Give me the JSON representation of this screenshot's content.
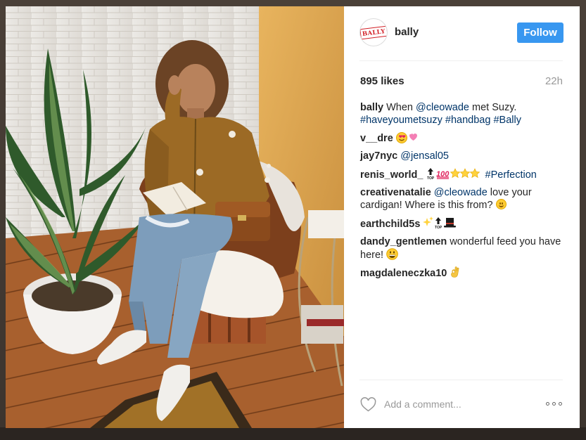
{
  "post": {
    "username": "bally",
    "avatar_logo_text": "BALLY",
    "follow_label": "Follow",
    "likes": "895 likes",
    "time": "22h",
    "comments": [
      {
        "author": "bally",
        "parts": [
          {
            "t": "text",
            "v": "When "
          },
          {
            "t": "mention",
            "v": "@cleowade"
          },
          {
            "t": "text",
            "v": " met Suzy. "
          },
          {
            "t": "tag",
            "v": "#haveyoumetsuzy"
          },
          {
            "t": "text",
            "v": " "
          },
          {
            "t": "tag",
            "v": "#handbag"
          },
          {
            "t": "text",
            "v": " "
          },
          {
            "t": "tag",
            "v": "#Bally"
          }
        ]
      },
      {
        "author": "v__dre",
        "parts": [
          {
            "t": "text",
            "v": ""
          }
        ],
        "emoji": [
          "heart-eyes-emoji",
          "sparkling-heart-emoji"
        ]
      },
      {
        "author": "jay7nyc",
        "parts": [
          {
            "t": "mention",
            "v": "@jensal05"
          }
        ]
      },
      {
        "author": "renis_world_",
        "parts": [
          {
            "t": "tag",
            "v": "#Perfection"
          }
        ],
        "emoji_before": [
          "top-arrow-emoji",
          "hundred-emoji",
          "star-emoji",
          "star-emoji",
          "star-emoji"
        ]
      },
      {
        "author": "creativenatalie",
        "parts": [
          {
            "t": "mention",
            "v": "@cleowade"
          },
          {
            "t": "text",
            "v": " love your cardigan! Where is this from?"
          }
        ],
        "emoji": [
          "smiling-face-emoji"
        ]
      },
      {
        "author": "earthchild5s",
        "parts": [
          {
            "t": "text",
            "v": ""
          }
        ],
        "emoji": [
          "sparkles-emoji",
          "top-arrow-emoji",
          "top-hat-emoji"
        ]
      },
      {
        "author": "dandy_gentlemen",
        "parts": [
          {
            "t": "text",
            "v": "wonderful feed you have here!"
          }
        ],
        "emoji": [
          "grinning-face-emoji"
        ]
      },
      {
        "author": "magdaleneczka10",
        "parts": [
          {
            "t": "text",
            "v": ""
          }
        ],
        "emoji": [
          "ok-hand-emoji"
        ]
      }
    ],
    "comment_placeholder": "Add a comment..."
  },
  "colors": {
    "follow_button": "#3897f0",
    "link": "#003569",
    "brand_red": "#d21f26"
  },
  "icons": [
    "heart-icon",
    "more-options-icon"
  ]
}
